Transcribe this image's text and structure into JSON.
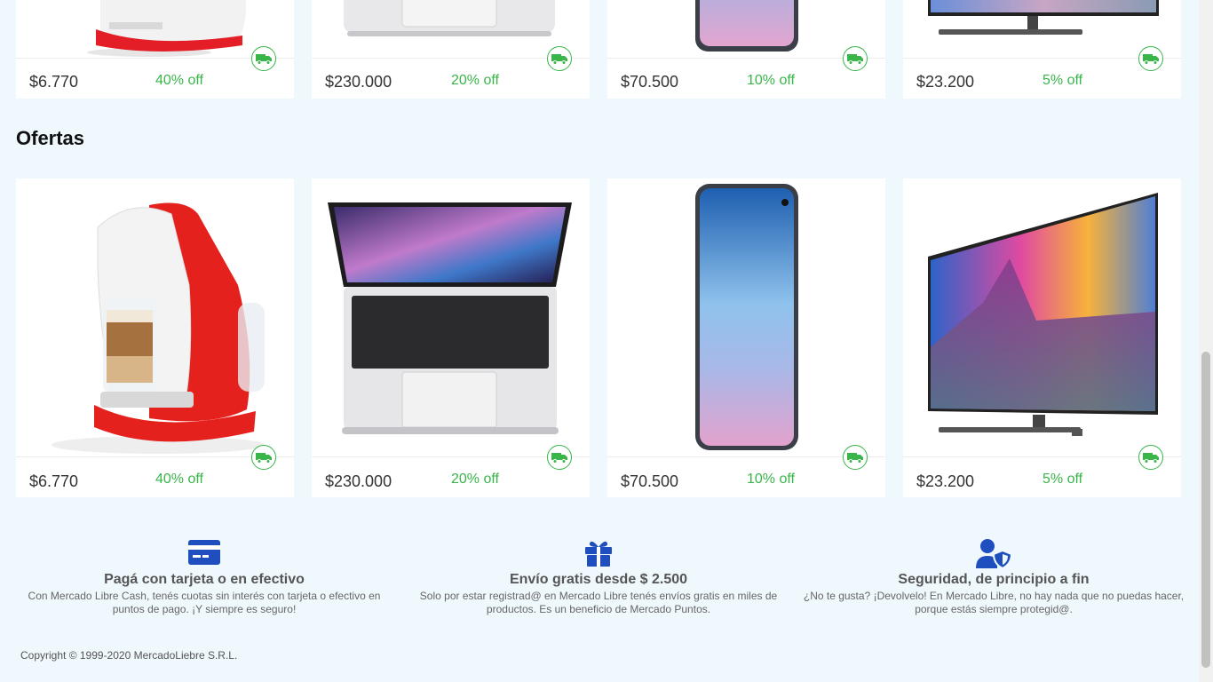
{
  "top_row": [
    {
      "price": "$6.770",
      "discount": "40% off"
    },
    {
      "price": "$230.000",
      "discount": "20% off"
    },
    {
      "price": "$70.500",
      "discount": "10% off"
    },
    {
      "price": "$23.200",
      "discount": "5% off"
    }
  ],
  "section_title": "Ofertas",
  "offers": [
    {
      "price": "$6.770",
      "discount": "40% off",
      "image": "coffee-machine"
    },
    {
      "price": "$230.000",
      "discount": "20% off",
      "image": "laptop"
    },
    {
      "price": "$70.500",
      "discount": "10% off",
      "image": "smartphone"
    },
    {
      "price": "$23.200",
      "discount": "5% off",
      "image": "television"
    }
  ],
  "features": [
    {
      "icon": "credit-card-icon",
      "title": "Pagá con tarjeta o en efectivo",
      "description": "Con Mercado Libre Cash, tenés cuotas sin interés con tarjeta o efectivo en puntos de pago. ¡Y siempre es seguro!"
    },
    {
      "icon": "gift-icon",
      "title": "Envío gratis desde $ 2.500",
      "description": "Solo por estar registrad@ en Mercado Libre tenés envíos gratis en miles de productos. Es un beneficio de Mercado Puntos."
    },
    {
      "icon": "user-shield-icon",
      "title": "Seguridad, de principio a fin",
      "description": "¿No te gusta? ¡Devolvelo! En Mercado Libre, no hay nada que no puedas hacer, porque estás siempre protegid@."
    }
  ],
  "copyright": "Copyright © 1999-2020 MercadoLiebre S.R.L.",
  "colors": {
    "background": "#eff8fd",
    "discount": "#39b54a",
    "icon_blue": "#1f4fbf"
  }
}
